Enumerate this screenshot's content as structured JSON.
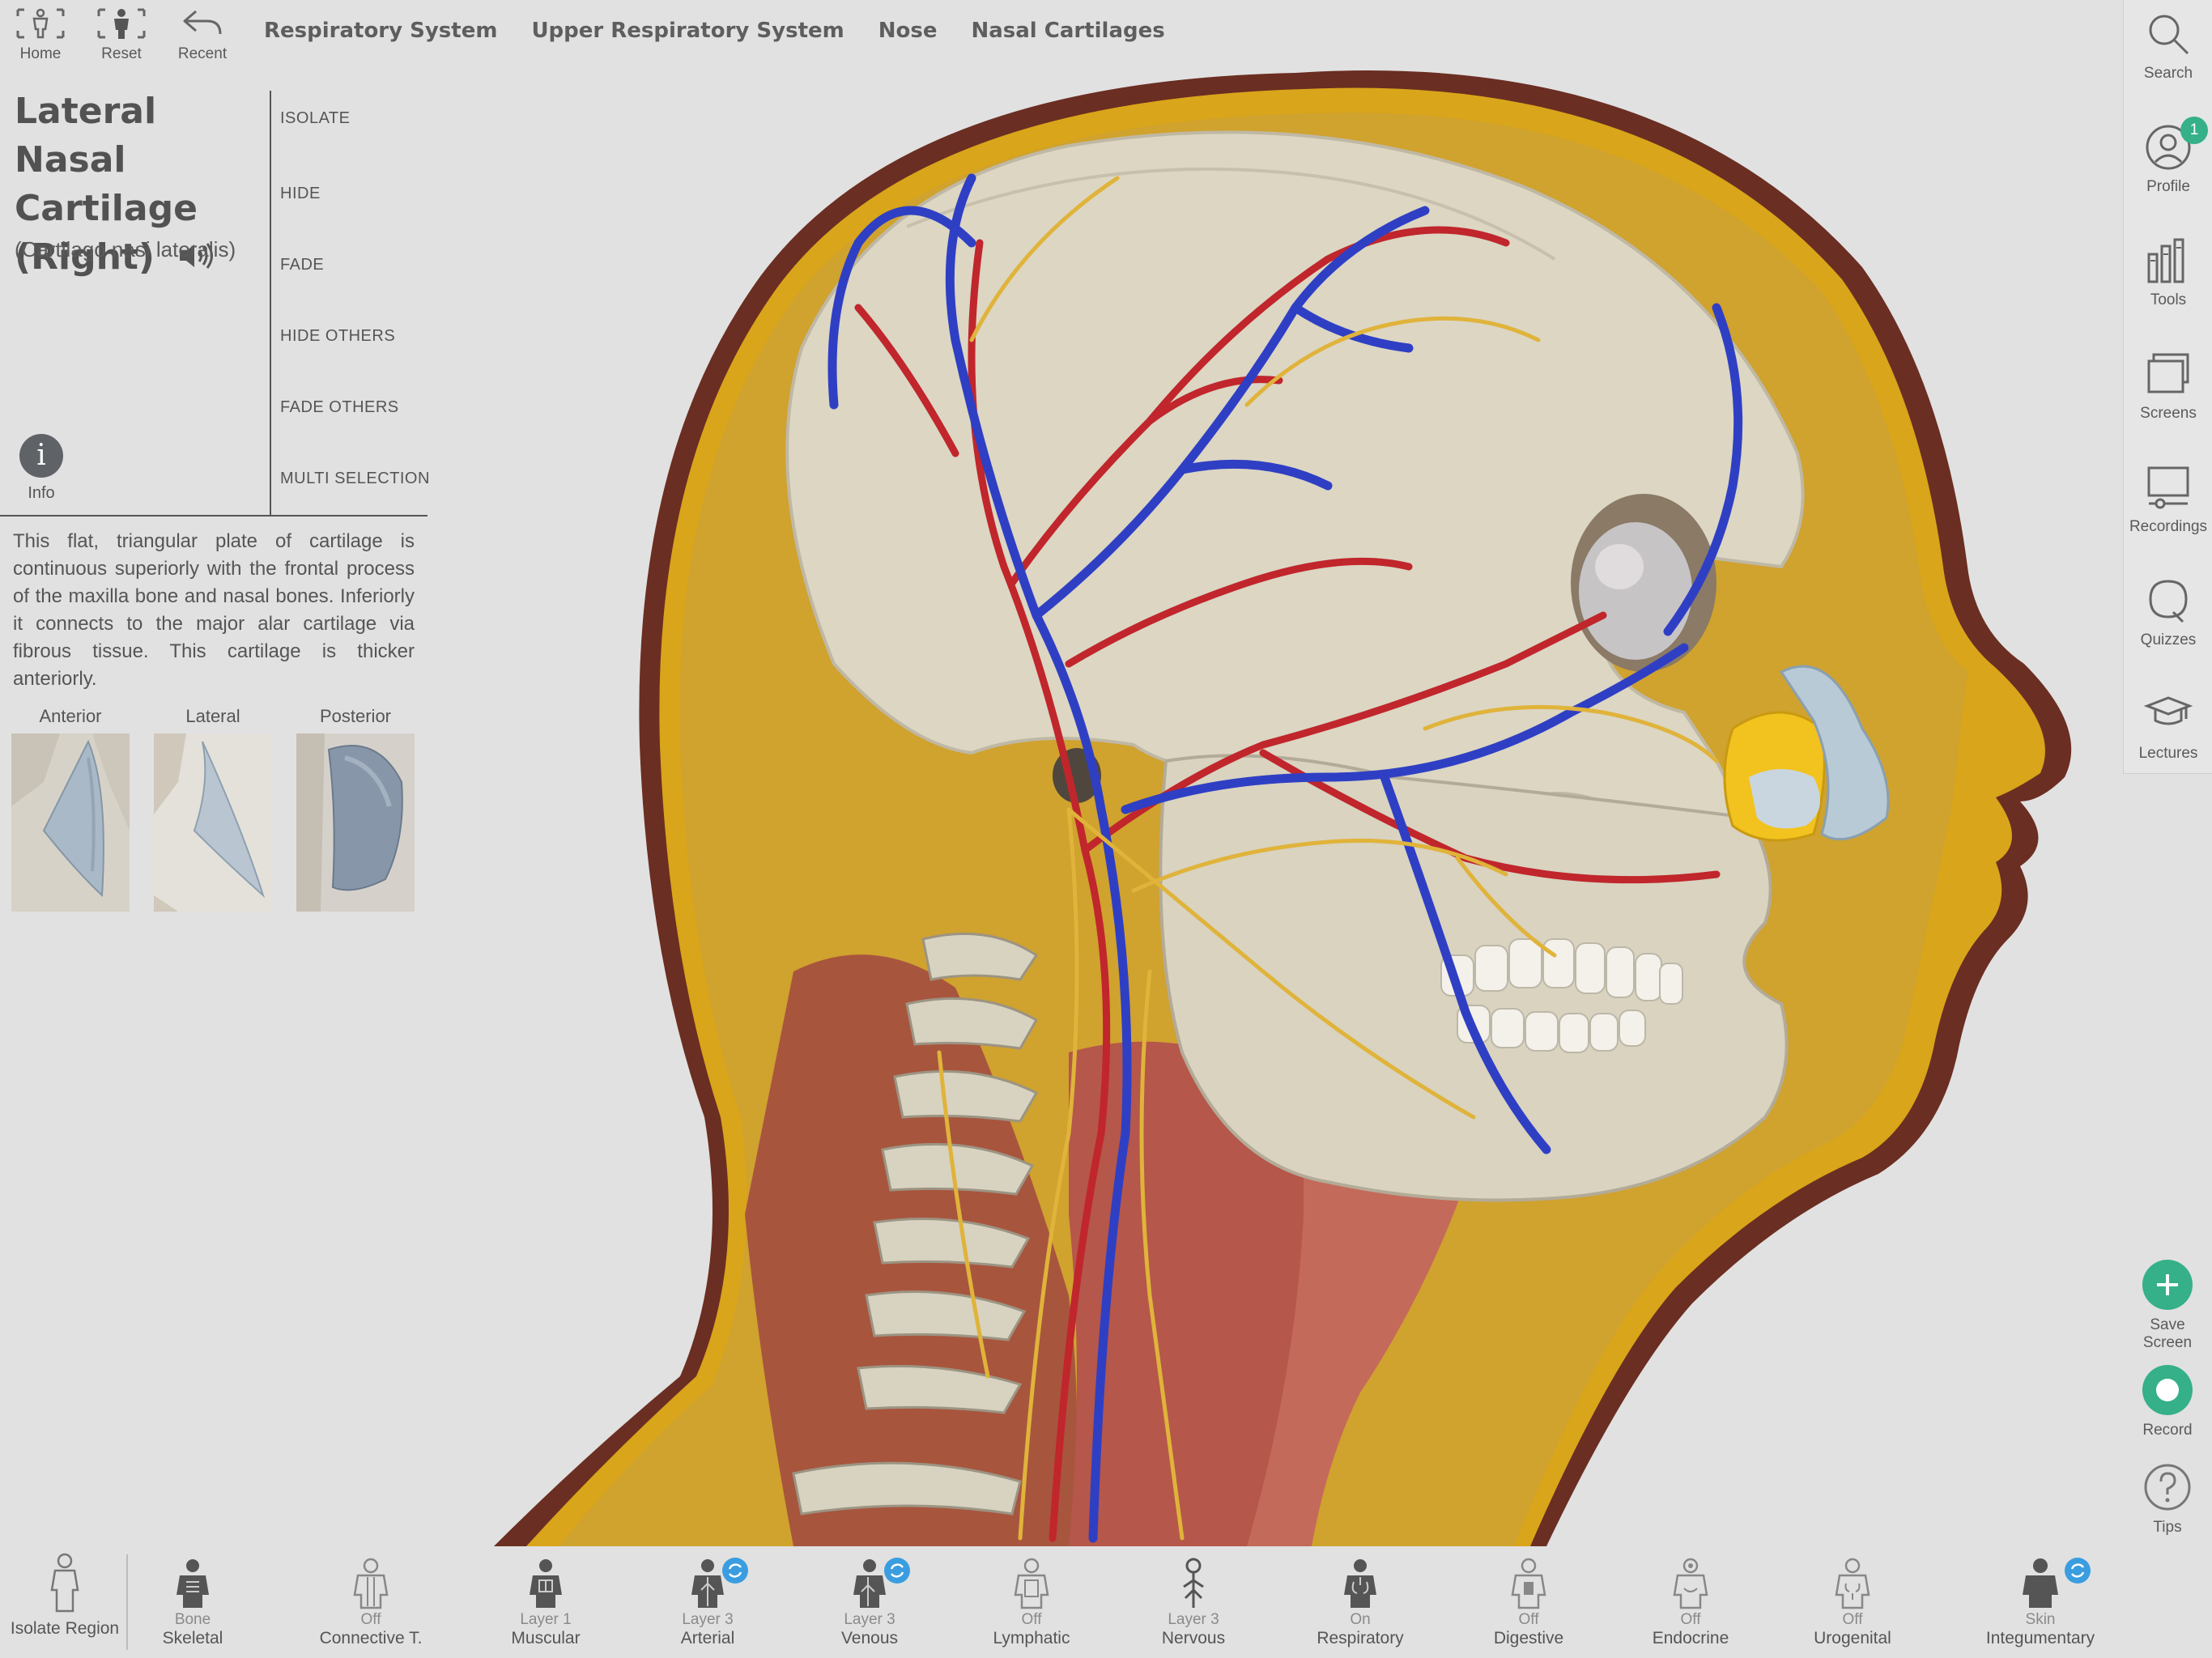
{
  "topbar": {
    "home_label": "Home",
    "reset_label": "Reset",
    "recent_label": "Recent",
    "breadcrumbs": [
      "Respiratory System",
      "Upper Respiratory System",
      "Nose",
      "Nasal Cartilages"
    ]
  },
  "structure": {
    "title": "Lateral Nasal Cartilage (Right)",
    "latin": "(Cartilago nasi lateralis)",
    "description": "This flat, triangular plate of cartilage is continuous superiorly with the frontal process of the maxilla bone and nasal bones. Inferiorly it connects to the major alar cartilage via fibrous tissue. This cartilage is thicker anteriorly.",
    "info_label": "Info",
    "actions": [
      "ISOLATE",
      "HIDE",
      "FADE",
      "HIDE OTHERS",
      "FADE OTHERS",
      "MULTI SELECTION"
    ],
    "views": [
      {
        "label": "Anterior"
      },
      {
        "label": "Lateral"
      },
      {
        "label": "Posterior"
      }
    ]
  },
  "rail": {
    "items": [
      {
        "label": "Search",
        "icon": "search-icon"
      },
      {
        "label": "Profile",
        "icon": "profile-icon",
        "badge": "1"
      },
      {
        "label": "Tools",
        "icon": "tools-icon"
      },
      {
        "label": "Screens",
        "icon": "screens-icon"
      },
      {
        "label": "Recordings",
        "icon": "recordings-icon"
      },
      {
        "label": "Quizzes",
        "icon": "quizzes-icon"
      },
      {
        "label": "Lectures",
        "icon": "lectures-icon"
      }
    ],
    "save_screen_label": "Save Screen",
    "record_label": "Record",
    "tips_label": "Tips"
  },
  "bottombar": {
    "isolate_region_label": "Isolate Region",
    "systems": [
      {
        "state": "Bone",
        "name": "Skeletal",
        "sync": false
      },
      {
        "state": "Off",
        "name": "Connective T.",
        "sync": false
      },
      {
        "state": "Layer 1",
        "name": "Muscular",
        "sync": false
      },
      {
        "state": "Layer 3",
        "name": "Arterial",
        "sync": true
      },
      {
        "state": "Layer 3",
        "name": "Venous",
        "sync": true
      },
      {
        "state": "Off",
        "name": "Lymphatic",
        "sync": false
      },
      {
        "state": "Layer 3",
        "name": "Nervous",
        "sync": false
      },
      {
        "state": "On",
        "name": "Respiratory",
        "sync": false
      },
      {
        "state": "Off",
        "name": "Digestive",
        "sync": false
      },
      {
        "state": "Off",
        "name": "Endocrine",
        "sync": false
      },
      {
        "state": "Off",
        "name": "Urogenital",
        "sync": false
      },
      {
        "state": "Skin",
        "name": "Integumentary",
        "sync": true
      }
    ]
  },
  "colors": {
    "accent_green": "#35b088",
    "sync_blue": "#3a9de0",
    "artery_red": "#c0262c",
    "vein_blue": "#2f3fc4",
    "nerve_yellow": "#e0b33a",
    "fat_yellow": "#e2b21c",
    "skull_bone": "#dcd7c5",
    "cartilage_highlight": "#f2c21f"
  }
}
